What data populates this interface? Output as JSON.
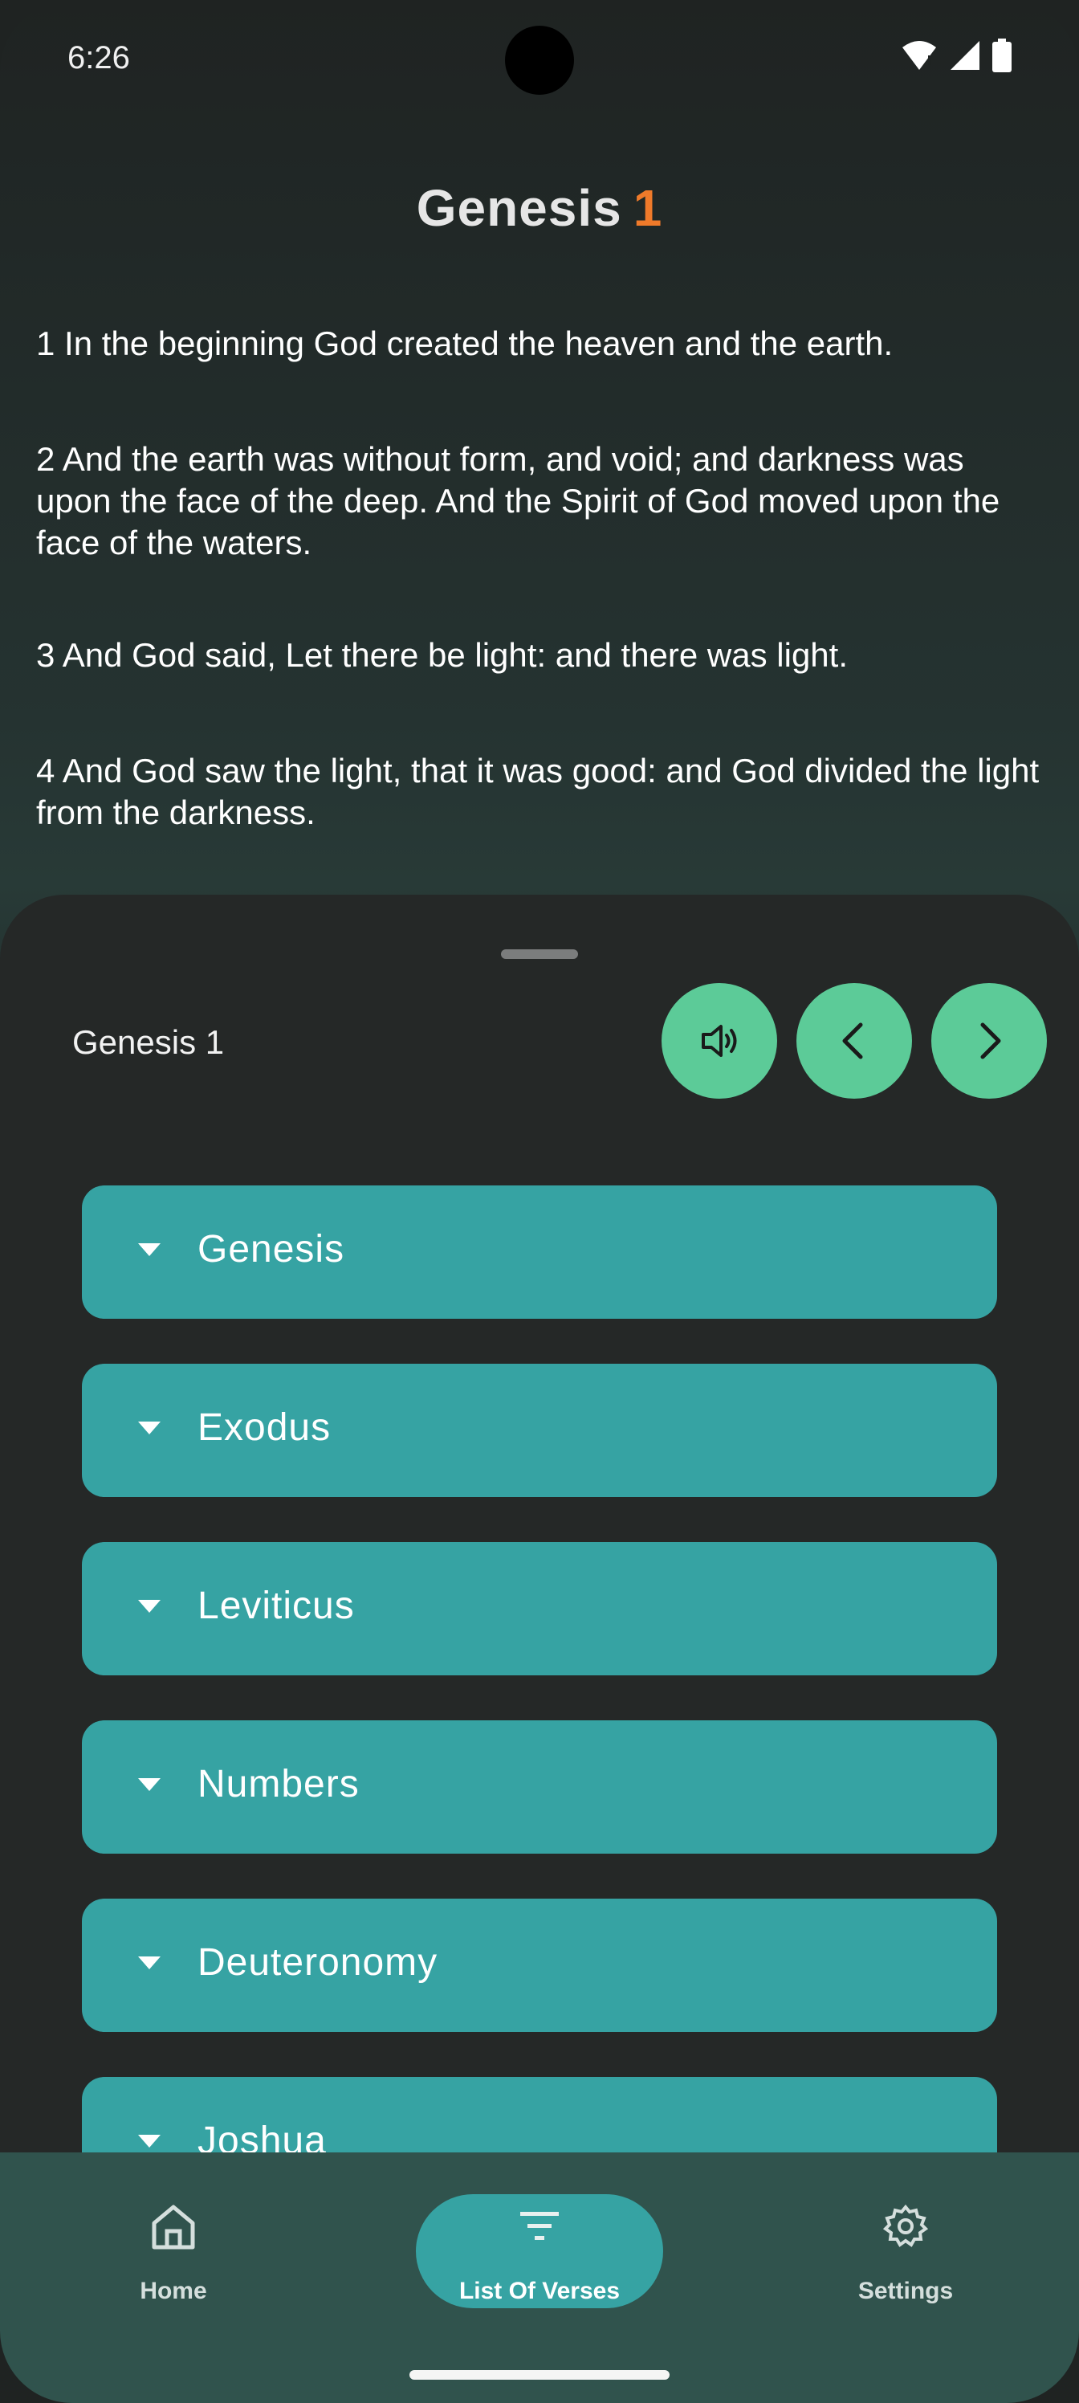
{
  "status_bar": {
    "time": "6:26"
  },
  "reader": {
    "book": "Genesis",
    "chapter": "1",
    "verses": [
      "1 In the beginning God created the heaven and the earth.",
      "2 And the earth was without form, and void; and darkness was upon the face of the deep. And the Spirit of God moved upon the face of the waters.",
      "3 And God said, Let there be light: and there was light.",
      "4 And God saw the light, that it was good: and God divided the light from the darkness."
    ]
  },
  "sheet": {
    "title": "Genesis 1",
    "buttons": {
      "audio_icon": "speaker-icon",
      "prev_icon": "chevron-left-icon",
      "next_icon": "chevron-right-icon"
    },
    "books": [
      "Genesis",
      "Exodus",
      "Leviticus",
      "Numbers",
      "Deuteronomy",
      "Joshua"
    ]
  },
  "nav": {
    "items": [
      {
        "label": "Home",
        "icon": "home-icon"
      },
      {
        "label": "List Of Verses",
        "icon": "filter-icon",
        "selected": true
      },
      {
        "label": "Settings",
        "icon": "gear-icon"
      }
    ]
  },
  "colors": {
    "accent_orange": "#ef7a2a",
    "action_green": "#5ccb98",
    "book_teal": "#36a3a3",
    "nav_bg": "#30534d"
  }
}
